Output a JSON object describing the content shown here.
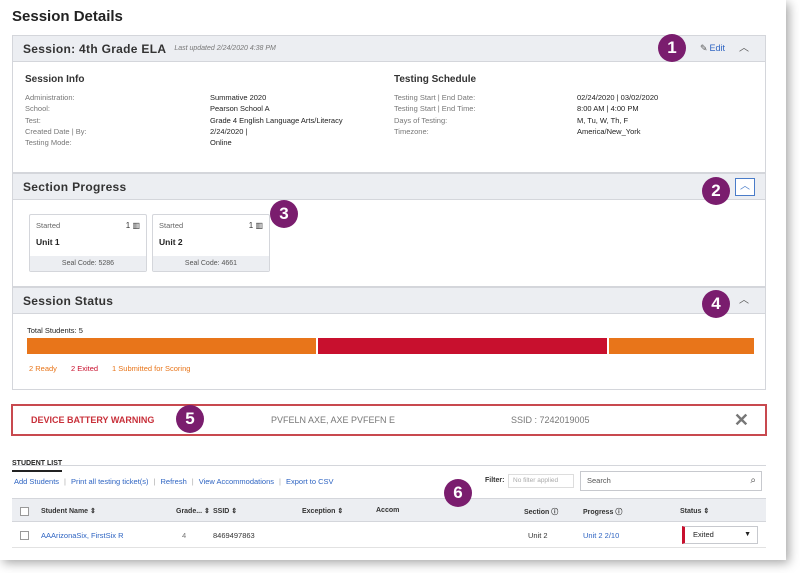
{
  "page": {
    "title": "Session Details"
  },
  "session": {
    "title": "Session: 4th Grade ELA",
    "last_updated": "Last updated 2/24/2020 4:38 PM",
    "edit_label": "Edit",
    "info_heading": "Session Info",
    "info": [
      {
        "label": "Administration:",
        "value": "Summative 2020"
      },
      {
        "label": "School:",
        "value": "Pearson School A"
      },
      {
        "label": "Test:",
        "value": "Grade 4 English Language Arts/Literacy"
      },
      {
        "label": "Created Date | By:",
        "value": "2/24/2020 |"
      },
      {
        "label": "Testing Mode:",
        "value": "Online"
      }
    ],
    "schedule_heading": "Testing Schedule",
    "schedule": [
      {
        "label": "Testing Start | End Date:",
        "value": "02/24/2020 | 03/02/2020"
      },
      {
        "label": "Testing Start | End Time:",
        "value": "8:00 AM | 4:00 PM"
      },
      {
        "label": "Days of Testing:",
        "value": "M, Tu, W, Th, F"
      },
      {
        "label": "Timezone:",
        "value": "America/New_York"
      }
    ]
  },
  "section_progress": {
    "title": "Section Progress",
    "units": [
      {
        "status": "Started",
        "count": "1",
        "name": "Unit 1",
        "seal": "Seal Code: 5286"
      },
      {
        "status": "Started",
        "count": "1",
        "name": "Unit 2",
        "seal": "Seal Code: 4661"
      }
    ]
  },
  "session_status": {
    "title": "Session Status",
    "total_label": "Total Students: 5",
    "bar_colors": {
      "ready": "#e8751a",
      "exited": "#c8102e",
      "submitted": "#e8751a"
    },
    "segments": [
      {
        "key": "ready",
        "fraction": 0.4
      },
      {
        "key": "exited",
        "fraction": 0.4
      },
      {
        "key": "submitted",
        "fraction": 0.2
      }
    ],
    "legend": [
      {
        "text": "2 Ready",
        "color": "#e8751a"
      },
      {
        "text": "2 Exited",
        "color": "#c8102e"
      },
      {
        "text": "1 Submitted for Scoring",
        "color": "#e8751a"
      }
    ]
  },
  "warning": {
    "title": "DEVICE BATTERY WARNING",
    "student": "PVFELN AXE, AXE PVFEFN E",
    "ssid": "SSID : 7242019005",
    "close_icon": "close-icon"
  },
  "student_list": {
    "tab_label": "STUDENT LIST",
    "actions": [
      "Add Students",
      "Print all testing ticket(s)",
      "Refresh",
      "View Accommodations",
      "Export to CSV"
    ],
    "filter_label": "Filter:",
    "filter_value": "No filter applied",
    "search_placeholder": "Search",
    "columns": {
      "name": "Student Name",
      "grade": "Grade...",
      "ssid": "SSID",
      "exception": "Exception",
      "accom": "Accom",
      "section": "Section",
      "progress": "Progress",
      "status": "Status"
    },
    "rows": [
      {
        "name": "AAArizonaSix, FirstSix R",
        "grade": "4",
        "ssid": "8469497863",
        "section": "Unit 2",
        "progress": "Unit 2 2/10",
        "status": "Exited"
      }
    ]
  },
  "badges": [
    "1",
    "2",
    "3",
    "4",
    "5",
    "6"
  ]
}
